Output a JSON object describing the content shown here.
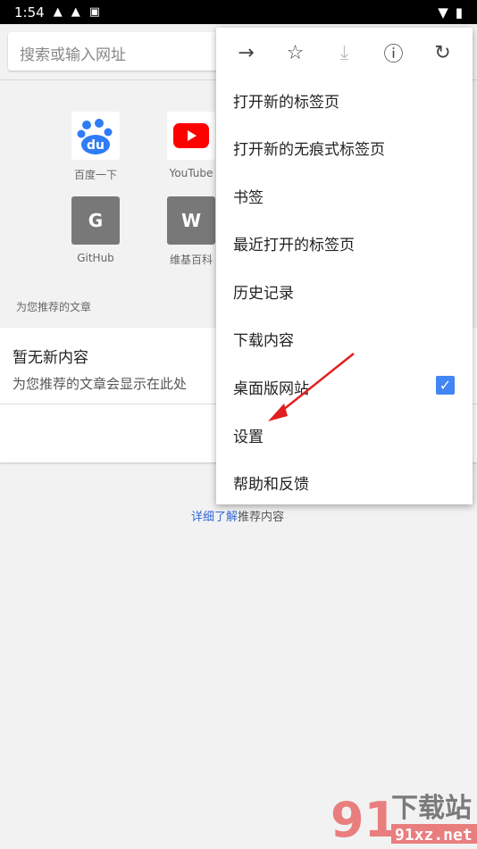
{
  "status_bar": {
    "time": "1:54",
    "icons": [
      "qq-icon",
      "qq-icon",
      "a-icon",
      "wifi-icon",
      "battery-charging-icon"
    ]
  },
  "search": {
    "placeholder": "搜索或输入网址"
  },
  "shortcuts": [
    {
      "label": "百度一下",
      "icon": "du"
    },
    {
      "label": "YouTube",
      "icon": "youtube-play"
    },
    {
      "label": "GitHub",
      "icon": "G"
    },
    {
      "label": "维基百科",
      "icon": "W"
    }
  ],
  "feed": {
    "section_title": "为您推荐的文章",
    "empty_title": "暂无新内容",
    "empty_subtitle": "为您推荐的文章会显示在此处",
    "learn_more_link": "详细了解",
    "learn_more_rest": "推荐内容"
  },
  "menu": {
    "icons": [
      "forward-icon",
      "bookmark-star-icon",
      "download-icon",
      "info-icon",
      "refresh-icon"
    ],
    "items": [
      "打开新的标签页",
      "打开新的无痕式标签页",
      "书签",
      "最近打开的标签页",
      "历史记录",
      "下载内容",
      "桌面版网站",
      "设置",
      "帮助和反馈"
    ],
    "desktop_site_checked": true
  },
  "watermark": {
    "text1": "下载站",
    "text2": "91xz.net",
    "logo": "91"
  },
  "colors": {
    "accent": "#4285f4",
    "link": "#3367d6",
    "arrow": "#e02020"
  }
}
